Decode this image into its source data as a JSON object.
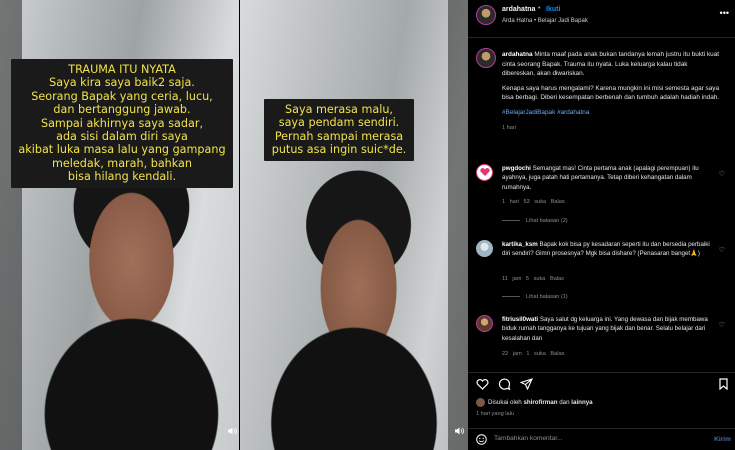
{
  "media": {
    "panel1": {
      "lines": [
        "TRAUMA ITU NYATA",
        "Saya kira saya baik2 saja.",
        "Seorang Bapak yang ceria, lucu,",
        "dan bertanggung jawab.",
        "Sampai akhirnya saya sadar,",
        "ada sisi dalam diri saya",
        "akibat luka masa lalu yang gampang",
        "meledak, marah, bahkan",
        "bisa hilang kendali."
      ],
      "volume_icon": "volume-icon"
    },
    "panel2": {
      "lines": [
        "Saya merasa malu,",
        "saya pendam sendiri.",
        "Pernah sampai merasa",
        "putus asa ingin suic*de."
      ],
      "volume_icon": "volume-icon"
    }
  },
  "header": {
    "username": "ardahatna",
    "dot": "•",
    "follow": "Ikuti",
    "subtitle": "Arda Hatna • Belajar Jadi Bapak",
    "more": "•••"
  },
  "caption": {
    "username": "ardahatna",
    "p1": "Minta maaf pada anak bukan tandanya lemah justru itu bukti kuat cinta seorang Bapak. Trauma itu nyata. Luka keluarga kalau tidak dibereskan, akan diwariskan.",
    "p2": "Kenapa saya harus mengalami? Karena mungkin ini misi semesta agar saya bisa berbagi. Diberi kesempatan berbenah dan tumbuh adalah hadiah indah.",
    "hashtags": "#BelajarJadiBapak #ardahatna",
    "time": "1 hari"
  },
  "comments": [
    {
      "username": "pwgdochi",
      "text": "Semangat mas! Cinta pertama anak (apalagi perempuan) itu ayahnya, juga patah hati pertamanya. Tetap diberi kehangatan dalam rumahnya.",
      "meta": "1 hari  53 suka  Balas",
      "replies": "Lihat balasan (2)"
    },
    {
      "username": "kartika_ksm",
      "text": "Bapak kok bisa py kesadaran seperti itu dan bersedia perbaiki diri sendiri? Gimn prosesnya? Mgk bisa dishare? (Penasaran banget🙏)",
      "meta": "11 jam  5 suka  Balas",
      "replies": "Lihat balasan (1)"
    },
    {
      "username": "fitriusil0wati",
      "text": "Saya salut dg keluarga ini. Yang dewasa dan bijak membawa biduk rumah tangganya ke tujuan yang bijak dan benar. Selalu belajar dari kesalahan dan",
      "meta": "22 jam  1 suka  Balas"
    }
  ],
  "actions": {
    "like_icon": "heart-icon",
    "comment_icon": "comment-icon",
    "share_icon": "send-icon",
    "save_icon": "bookmark-icon"
  },
  "likes": {
    "prefix": "Disukai oleh",
    "user": "shirofirman",
    "and": "dan",
    "others": "lainnya"
  },
  "time": "1 hari yang lalu",
  "add_comment": {
    "placeholder": "Tambahkan komentar...",
    "send": "Kirim"
  }
}
